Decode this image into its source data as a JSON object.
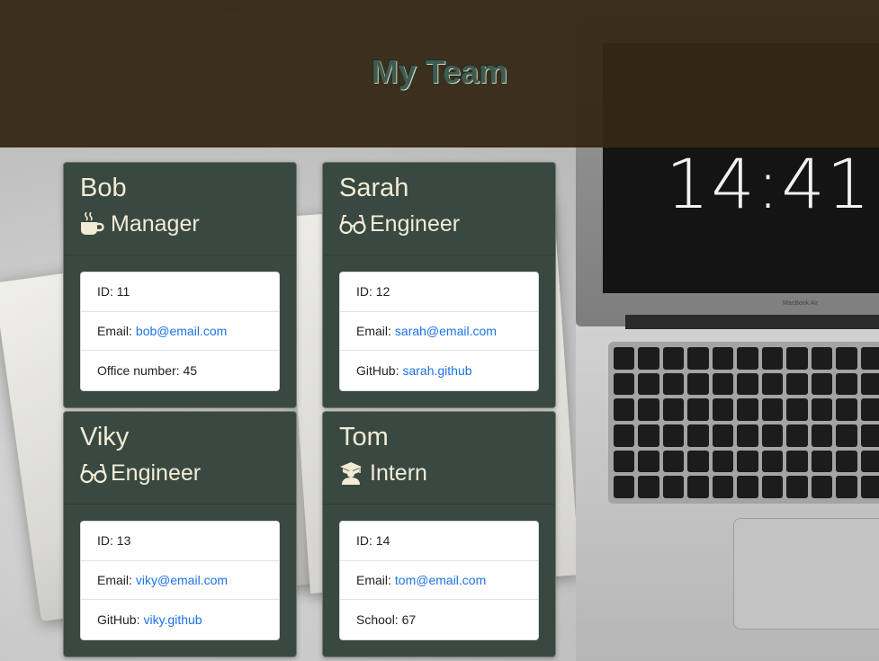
{
  "header": {
    "title": "My Team"
  },
  "background": {
    "clock_time": "14:41",
    "laptop_brand": "MacBook Air"
  },
  "team": [
    {
      "name": "Bob",
      "role": "Manager",
      "icon": "coffee-mug-icon",
      "id_label": "ID: 11",
      "email_label": "Email:",
      "email": "bob@email.com",
      "extra_label": "Office number: 45",
      "extra_link": ""
    },
    {
      "name": "Sarah",
      "role": "Engineer",
      "icon": "glasses-icon",
      "id_label": "ID: 12",
      "email_label": "Email:",
      "email": "sarah@email.com",
      "extra_label": "GitHub:",
      "extra_link": "sarah.github"
    },
    {
      "name": "Viky",
      "role": "Engineer",
      "icon": "glasses-icon",
      "id_label": "ID: 13",
      "email_label": "Email:",
      "email": "viky@email.com",
      "extra_label": "GitHub:",
      "extra_link": "viky.github"
    },
    {
      "name": "Tom",
      "role": "Intern",
      "icon": "graduation-cap-icon",
      "id_label": "ID: 14",
      "email_label": "Email:",
      "email": "tom@email.com",
      "extra_label": "School: 67",
      "extra_link": ""
    }
  ],
  "colors": {
    "header_bg": "#342814",
    "card_bg": "#394941",
    "card_text": "#f2ebd6",
    "link": "#1a73e8"
  }
}
